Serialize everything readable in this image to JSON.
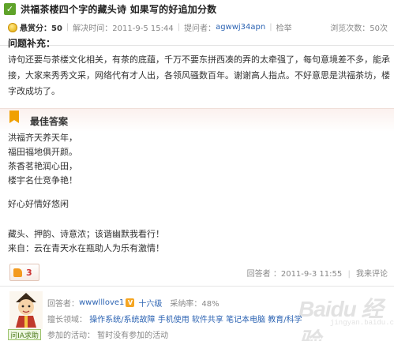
{
  "question": {
    "title": "洪福茶楼四个字的藏头诗 如果写的好追加分数",
    "reward": "悬赏分：50",
    "status": "解决时间：2011-9-5 15:44",
    "asker_label": "提问者：",
    "asker": "agwwj34apn",
    "report": "检举",
    "views": "浏览次数：50次"
  },
  "supplement": {
    "title": "问题补充：",
    "text": "诗句还要与茶楼文化相关，有茶的底蕴，千万不要东拼西凑的弄的太牵强了，每句意境差不多，能承接，大家来秀秀文采，网络代有才人出，各领风骚数百年。谢谢高人指点。不好意思是洪福茶坊，楼字改成坊了。"
  },
  "best_answer": {
    "title": "最佳答案",
    "lines": [
      "洪福齐天养天年，",
      "福田福地俱开颜。",
      "茶香茗艳润心田，",
      "楼宇名仕竞争艳！",
      "好心好情好悠闲",
      "藏头、押韵、诗意浓；该谐幽默我看行！",
      "来自：云在青天水在瓶助人为乐有激情！"
    ],
    "likes": "3",
    "answer_time": "回答者 ：2011-9-3 11:55",
    "comment": "我来评论"
  },
  "answerer": {
    "label": "回答者：",
    "name": "wwwlllove1",
    "v_badge": "V",
    "level": "十六级",
    "adopt_rate": "采纳率：48%",
    "field_label": "擅长领域：",
    "fields": "操作系统/系统故障 手机使用 软件共享 笔记本电脑 教育/科学",
    "activity": "参加的活动：  暂时没有参加的活动",
    "badge": "问IA求助"
  },
  "watermark": {
    "brand": "Baidu 经验",
    "sub": "jingyan.baidu.com"
  },
  "colors": {
    "link": "#2d64b3",
    "accent_orange": "#f0a000",
    "check_green": "#5fa32a"
  }
}
